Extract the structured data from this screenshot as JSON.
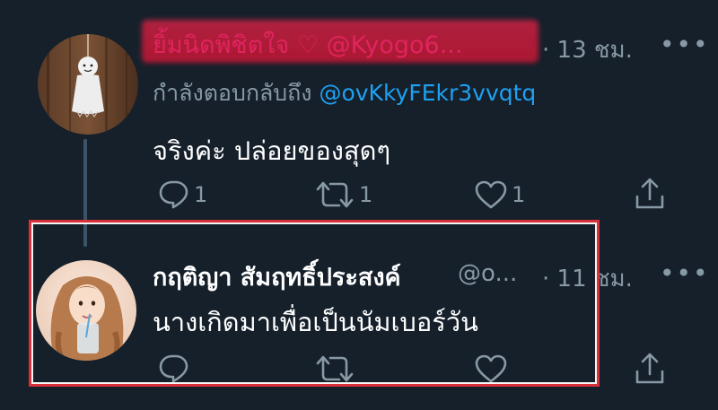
{
  "tweet1": {
    "display_name": "ยิ้มนิดพิชิตใจ ♡ @Kyogo6...",
    "time": "· 13 ชม.",
    "reply_prefix": "กำลังตอบกลับถึง",
    "reply_handle": "@ovKkyFEkr3vvqtq",
    "text": "จริงค่ะ ปล่อยของสุดๆ",
    "reply_count": "1",
    "retweet_count": "1",
    "like_count": "1",
    "more": "•••"
  },
  "tweet2": {
    "display_name": "กฤติญา สัมฤทธิ์ประสงค์",
    "handle": "@o...",
    "time": "· 11 ชม.",
    "text": "นางเกิดมาเพื่อเป็นนัมเบอร์วัน",
    "more": "•••"
  },
  "colors": {
    "background": "#15202b",
    "muted": "#8899a6",
    "link": "#1da1f2",
    "highlight": "#d8303a",
    "redaction": "#e0245e"
  },
  "icons": [
    "reply-icon",
    "retweet-icon",
    "like-icon",
    "share-icon"
  ]
}
